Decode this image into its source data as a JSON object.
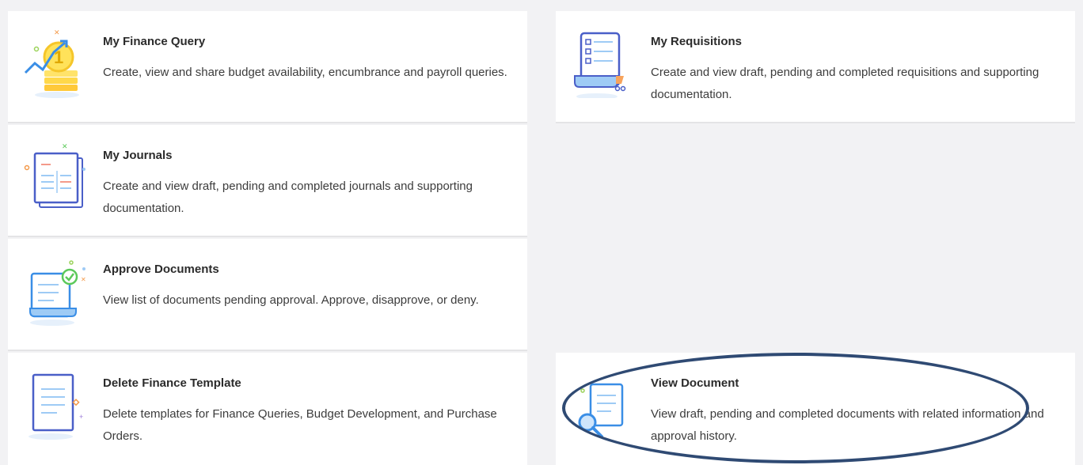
{
  "cards": {
    "finance_query": {
      "title": "My Finance Query",
      "description": "Create, view and share budget availability, encumbrance and payroll queries.",
      "icon": "coin-stack-icon"
    },
    "requisitions": {
      "title": "My Requisitions",
      "description": "Create and view draft, pending and completed requisitions and supporting documentation.",
      "icon": "requisition-list-icon"
    },
    "journals": {
      "title": "My Journals",
      "description": "Create and view draft, pending and completed journals and supporting documentation.",
      "icon": "journal-icon"
    },
    "approve": {
      "title": "Approve Documents",
      "description": "View list of documents pending approval. Approve, disapprove, or deny.",
      "icon": "approved-document-icon"
    },
    "delete_template": {
      "title": "Delete Finance Template",
      "description": "Delete templates for Finance Queries, Budget Development, and Purchase Orders.",
      "icon": "template-document-icon"
    },
    "view_document": {
      "title": "View Document",
      "description": "View draft, pending and completed documents with related information and approval history.",
      "icon": "document-search-icon"
    }
  },
  "colors": {
    "background": "#f2f2f4",
    "card": "#ffffff",
    "accent_blue": "#3a8ee6",
    "annotation_ellipse": "#2f4a73"
  }
}
